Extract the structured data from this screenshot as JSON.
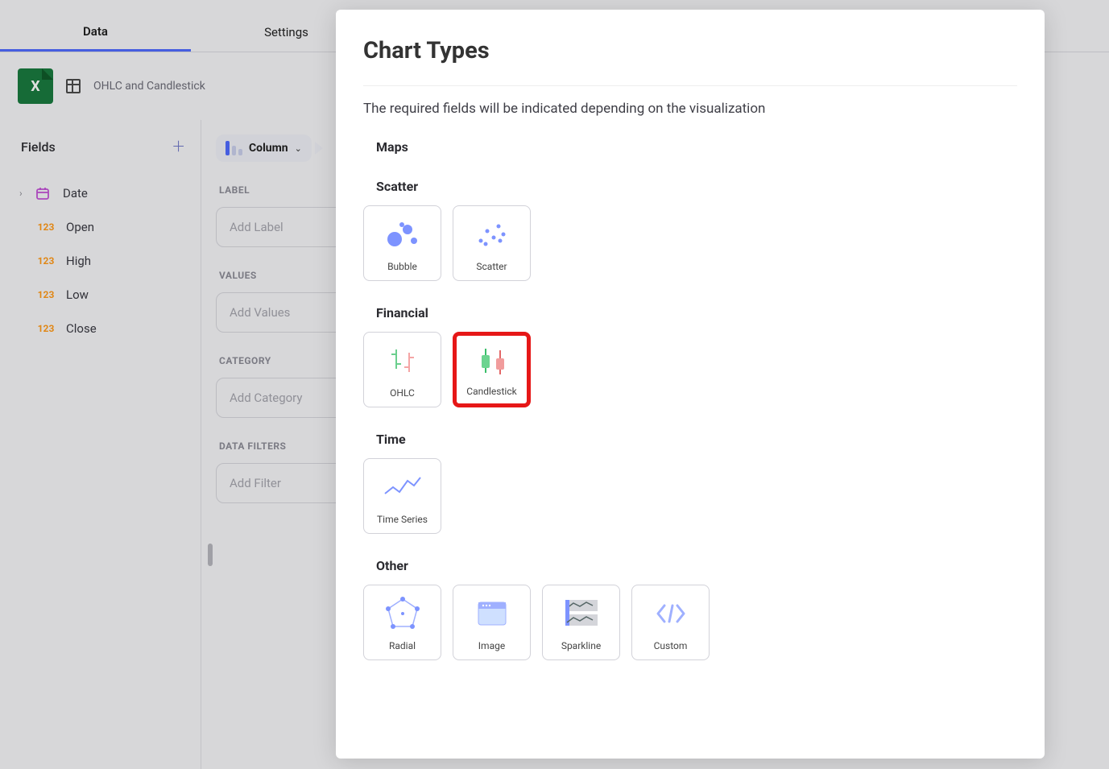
{
  "tabs": {
    "data": "Data",
    "settings": "Settings"
  },
  "source": {
    "name": "OHLC and Candlestick"
  },
  "fieldsHeader": "Fields",
  "fields": [
    {
      "type": "date",
      "label": "Date"
    },
    {
      "type": "num",
      "label": "Open"
    },
    {
      "type": "num",
      "label": "High"
    },
    {
      "type": "num",
      "label": "Low"
    },
    {
      "type": "num",
      "label": "Close"
    }
  ],
  "chartPill": "Column",
  "configSections": {
    "label": {
      "title": "LABEL",
      "placeholder": "Add Label"
    },
    "values": {
      "title": "VALUES",
      "placeholder": "Add Values"
    },
    "category": {
      "title": "CATEGORY",
      "placeholder": "Add Category"
    },
    "filters": {
      "title": "DATA FILTERS",
      "placeholder": "Add Filter"
    }
  },
  "popover": {
    "title": "Chart Types",
    "subtitle": "The required fields will be indicated depending on the visualization",
    "groups": {
      "maps": "Maps",
      "scatter": "Scatter",
      "financial": "Financial",
      "time": "Time",
      "other": "Other"
    },
    "cards": {
      "bubble": "Bubble",
      "scatter": "Scatter",
      "ohlc": "OHLC",
      "candlestick": "Candlestick",
      "timeseries": "Time Series",
      "radial": "Radial",
      "image": "Image",
      "sparkline": "Sparkline",
      "custom": "Custom"
    }
  }
}
